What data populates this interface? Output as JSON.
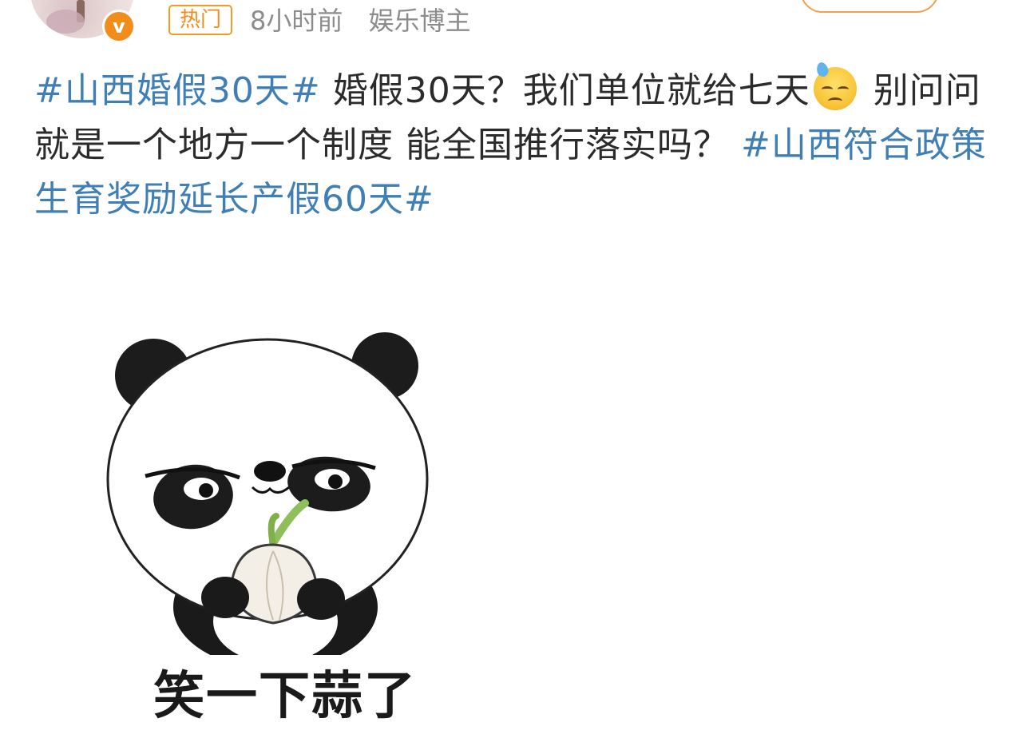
{
  "header": {
    "hot_tag": "热门",
    "time_ago": "8小时前",
    "author_type": "娱乐博主",
    "verified_mark": "v",
    "follow_label": ""
  },
  "post": {
    "topic_1": "#山西婚假30天#",
    "text_1": " 婚假30天？我们单位就给七天",
    "emoji_1": "sweat-face-icon",
    "text_2": " 别问问就是一个地方一个制度 能全国推行落实吗？ ",
    "topic_2": "#山西符合政策生育奖励延长产假60天#"
  },
  "sticker": {
    "caption": "笑一下蒜了",
    "description_icon": "panda-holding-garlic-icon"
  },
  "colors": {
    "topic": "#3f7fb5",
    "text": "#2b2b2b",
    "meta": "#8c8c8c",
    "accent": "#f28c1b"
  }
}
